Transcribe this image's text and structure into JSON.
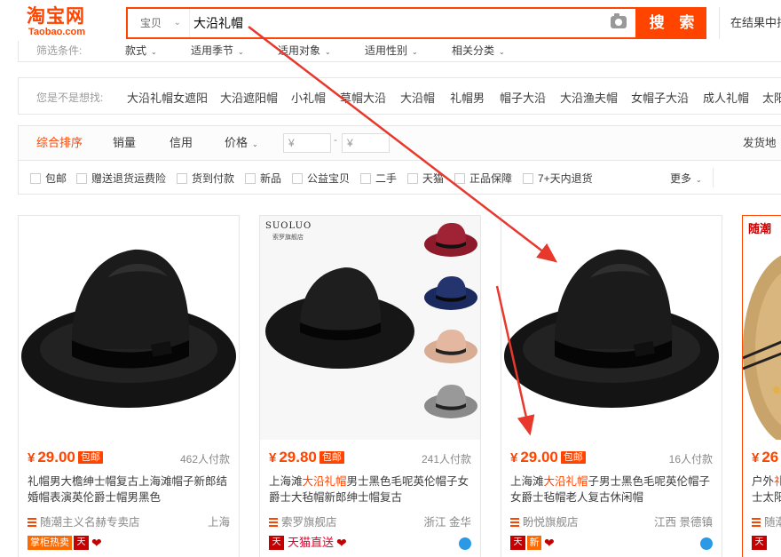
{
  "header": {
    "logo_cn": "淘宝网",
    "logo_en": "Taobao.com",
    "search_category": "宝贝",
    "search_query": "大沿礼帽",
    "search_button": "搜 索",
    "in_result": "在结果中排"
  },
  "filters": {
    "label": "筛选条件:",
    "items": [
      "款式",
      "适用季节",
      "适用对象",
      "适用性别",
      "相关分类"
    ]
  },
  "related": {
    "label": "您是不是想找:",
    "items": [
      "大沿礼帽女遮阳",
      "大沿遮阳帽",
      "小礼帽",
      "草帽大沿",
      "大沿帽",
      "礼帽男",
      "帽子大沿",
      "大沿渔夫帽",
      "女帽子大沿",
      "成人礼帽",
      "太阳"
    ]
  },
  "sort": {
    "items": [
      "综合排序",
      "销量",
      "信用",
      "价格"
    ],
    "price_from": "¥",
    "price_to": "¥",
    "dash": "-",
    "ship_from": "发货地"
  },
  "checks": {
    "items": [
      "包邮",
      "赠送退货运费险",
      "货到付款",
      "新品",
      "公益宝贝",
      "二手",
      "天猫",
      "正品保障",
      "7+天内退货"
    ],
    "more": "更多"
  },
  "products": [
    {
      "price": "29.00",
      "yen": "¥",
      "baoyou": "包邮",
      "sold": "462人付款",
      "title_pre": "礼帽男大檐绅士帽复古上海滩帽子新郎结婚帽表演英伦爵士帽男黑色",
      "title_hl": "",
      "title_post": "",
      "shop": "随潮主义名赫专卖店",
      "location": "上海",
      "badge_text": "掌柜热卖",
      "tmall": "天"
    },
    {
      "price": "29.80",
      "yen": "¥",
      "baoyou": "包邮",
      "sold": "241人付款",
      "title_pre": "上海滩",
      "title_hl": "大沿礼帽",
      "title_post": "男士黑色毛呢英伦帽子女爵士大毡帽新郎绅士帽复古",
      "shop": "索罗旗舰店",
      "location": "浙江 金华",
      "brand": "SUOLUO",
      "brand_sub": "索罗旗舰店",
      "direct": "天猫直送",
      "tmall": "天"
    },
    {
      "price": "29.00",
      "yen": "¥",
      "baoyou": "包邮",
      "sold": "16人付款",
      "title_pre": "上海滩",
      "title_hl": "大沿礼帽",
      "title_post": "子男士黑色毛呢英伦帽子女爵士毡帽老人复古休闲帽",
      "shop": "盼悦旗舰店",
      "location": "江西 景德镇",
      "xin": "新",
      "tmall": "天"
    },
    {
      "price": "26",
      "yen": "¥",
      "promo": "随潮",
      "title_pre": "户外",
      "title_hl": "礼",
      "title_post": "",
      "title_line2": "士太阳",
      "shop": "随潮",
      "tmall": "天"
    }
  ],
  "colors": {
    "accent": "#ff4400",
    "arrow": "#e8382c"
  }
}
